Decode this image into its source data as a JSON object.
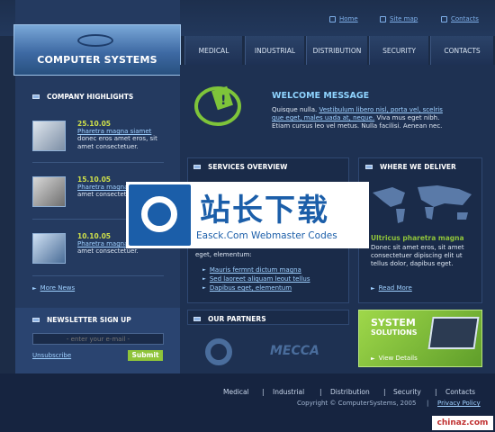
{
  "header": {
    "links": [
      {
        "label": "Home",
        "icon": "home-icon"
      },
      {
        "label": "Site map",
        "icon": "sitemap-icon"
      },
      {
        "label": "Contacts",
        "icon": "contacts-icon"
      }
    ],
    "logo_text": "COMPUTER SYSTEMS"
  },
  "nav": [
    "MEDICAL",
    "INDUSTRIAL",
    "DISTRIBUTION",
    "SECURITY",
    "CONTACTS"
  ],
  "highlights": {
    "title": "COMPANY HIGHLIGHTS",
    "items": [
      {
        "date": "25.10.05",
        "link": "Pharetra magna siamet",
        "text": "donec eros amet eros, sit amet consectetuer."
      },
      {
        "date": "15.10.05",
        "link": "Pharetra magna",
        "text": "amet consectetuer."
      },
      {
        "date": "10.10.05",
        "link": "Pharetra magna",
        "text": "amet consectetuer."
      }
    ],
    "more": "More News"
  },
  "newsletter": {
    "title": "NEWSLETTER SIGN UP",
    "placeholder": "- enter your e-mail -",
    "unsubscribe": "Unsubscribe",
    "submit": "Submit"
  },
  "welcome": {
    "title": "WELCOME MESSAGE",
    "line1_pre": "Quisque nulla. ",
    "line1_link": "Vestibulum libero nisl, porta vel, scelris",
    "line2_link": "que eget, males uada at, neque.",
    "line2_post": " Viva mus eget nibh.",
    "line3": "Etiam cursus leo vel metus. Nulla facilisi. Aenean nec."
  },
  "services": {
    "title": "SERVICES OVERVIEW",
    "intro": "eget, elementum:",
    "items": [
      "Mauris fermnt dictum magna",
      "Sed laoreet aliquam leout tellus",
      "Dapibus eget, elementum"
    ]
  },
  "deliver": {
    "title": "WHERE WE DELIVER",
    "subtitle": "Ultricus pharetra magna",
    "text": "Donec sit amet eros, sit amet consectetuer dipiscing elit ut tellus dolor, dapibus eget.",
    "more": "Read More"
  },
  "partners": {
    "title": "OUR PARTNERS",
    "names": [
      "MECCA"
    ]
  },
  "promo": {
    "line1": "SYSTEM",
    "line2": "SOLUTIONS",
    "link": "View Details"
  },
  "watermark": {
    "cn": "站长下载",
    "en": "Easck.Com Webmaster Codes"
  },
  "footer": {
    "links": [
      "Medical",
      "Industrial",
      "Distribution",
      "Security",
      "Contacts"
    ],
    "separator": "|",
    "copyright": "Copyright © ComputerSystems, 2005",
    "privacy": "Privacy Policy"
  },
  "corner_mark": "chinaz.com",
  "colors": {
    "accent_green": "#8fc43a",
    "date_yellow": "#cfe04a",
    "link_blue": "#9fd0ff"
  }
}
